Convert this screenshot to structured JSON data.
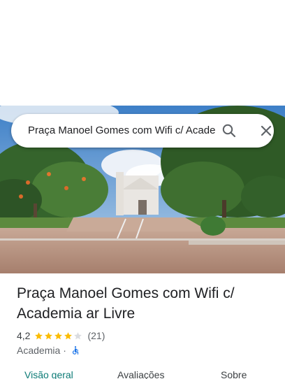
{
  "search": {
    "query": "Praça Manoel Gomes com Wifi c/ Academia ar Livre",
    "search_icon": "search-icon",
    "close_icon": "close-icon"
  },
  "place": {
    "title": "Praça Manoel Gomes com Wifi c/ Academia ar Livre",
    "rating": "4,2",
    "stars": 4.2,
    "reviews": "(21)",
    "category": "Academia",
    "separator": "·",
    "accessibility_icon": "wheelchair-icon"
  },
  "tabs": [
    {
      "label": "Visão geral",
      "active": true
    },
    {
      "label": "Avaliações",
      "active": false
    },
    {
      "label": "Sobre",
      "active": false
    }
  ],
  "colors": {
    "star": "#fbbc04",
    "star_empty": "#dadce0",
    "active_tab": "#0b7a75",
    "accessibility": "#1a73e8"
  }
}
